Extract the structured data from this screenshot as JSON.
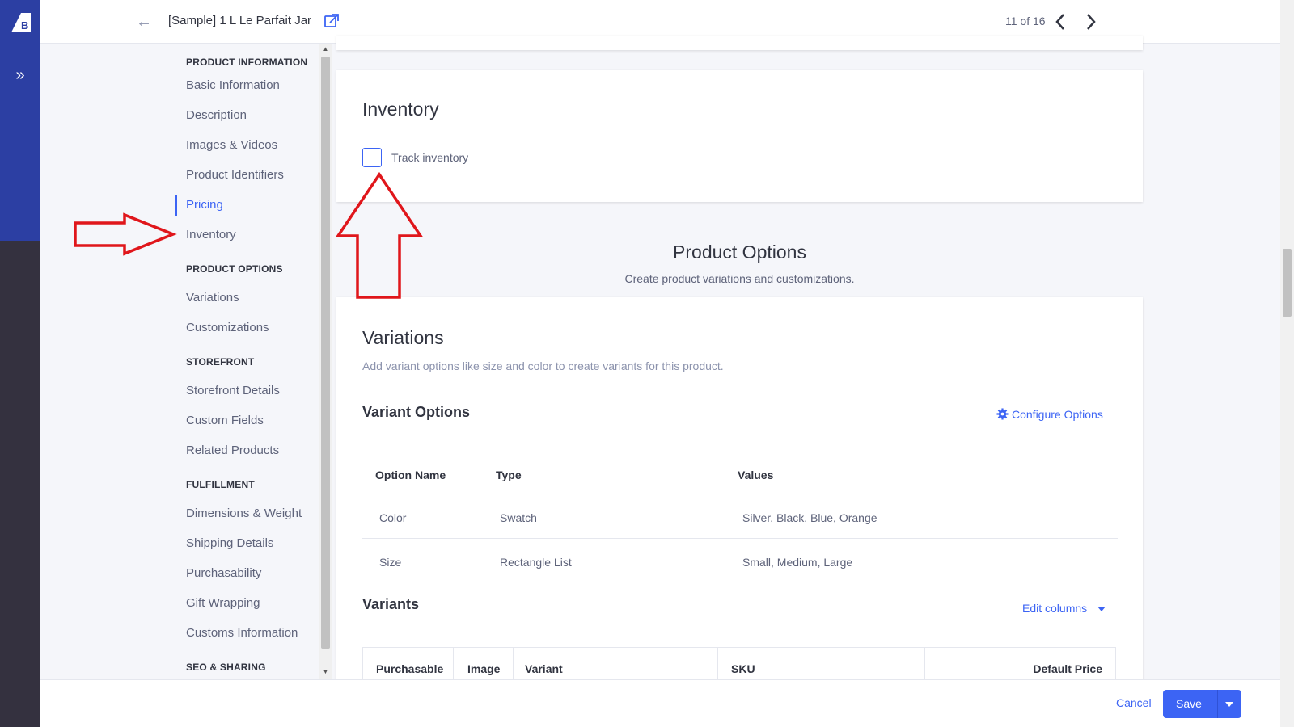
{
  "header": {
    "product_title": "[Sample] 1 L Le Parfait Jar",
    "pager": "11 of 16"
  },
  "sidenav": {
    "sections": [
      {
        "heading": "PRODUCT INFORMATION",
        "items": [
          "Basic Information",
          "Description",
          "Images & Videos",
          "Product Identifiers",
          "Pricing",
          "Inventory"
        ]
      },
      {
        "heading": "PRODUCT OPTIONS",
        "items": [
          "Variations",
          "Customizations"
        ]
      },
      {
        "heading": "STOREFRONT",
        "items": [
          "Storefront Details",
          "Custom Fields",
          "Related Products"
        ]
      },
      {
        "heading": "FULFILLMENT",
        "items": [
          "Dimensions & Weight",
          "Shipping Details",
          "Purchasability",
          "Gift Wrapping",
          "Customs Information"
        ]
      },
      {
        "heading": "SEO & SHARING",
        "items": []
      }
    ],
    "active_item": "Pricing"
  },
  "inventory": {
    "title": "Inventory",
    "track_label": "Track inventory",
    "track_checked": false
  },
  "product_options": {
    "title": "Product Options",
    "subtitle": "Create product variations and customizations."
  },
  "variations": {
    "title": "Variations",
    "subtitle": "Add variant options like size and color to create variants for this product.",
    "options_title": "Variant Options",
    "configure_label": "Configure Options",
    "columns": [
      "Option Name",
      "Type",
      "Values"
    ],
    "rows": [
      {
        "name": "Color",
        "type": "Swatch",
        "values": "Silver, Black, Blue, Orange"
      },
      {
        "name": "Size",
        "type": "Rectangle List",
        "values": "Small, Medium, Large"
      }
    ],
    "variants_title": "Variants",
    "edit_columns_label": "Edit columns",
    "variant_columns": [
      "Purchasable",
      "Image",
      "Variant",
      "SKU",
      "Default Price"
    ]
  },
  "footer": {
    "cancel_label": "Cancel",
    "save_label": "Save"
  },
  "colors": {
    "accent": "#3c64f4",
    "rail": "#34313f",
    "rail_top": "#2c3fa3",
    "annotation": "#e0161b"
  },
  "icons": {
    "logo": "bigcommerce-logo-icon",
    "expand": "double-chevron-right-icon",
    "back": "arrow-left-icon",
    "external": "external-link-icon",
    "prev": "chevron-left-icon",
    "next": "chevron-right-icon",
    "configure": "gear-icon"
  }
}
